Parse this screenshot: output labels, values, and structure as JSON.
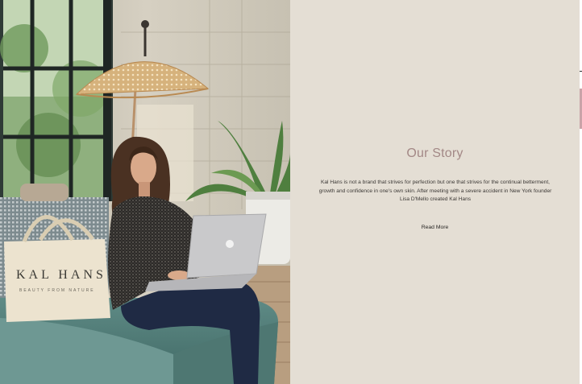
{
  "story": {
    "title": "Our Story",
    "body": "Kal Hans is not a brand that strives for perfection but one that strives for the continual betterment, growth and confidence in one's own skin. After meeting with a severe accident in New York founder Lisa D'Mello created Kal Hans",
    "read_more_label": "Read More"
  },
  "photo": {
    "bag_brand": "KAL HANS",
    "bag_tagline": "BEAUTY FROM NATURE"
  },
  "colors": {
    "panel_background": "#e4ded4",
    "title_accent": "#a38886",
    "body_text": "#3b3835"
  }
}
